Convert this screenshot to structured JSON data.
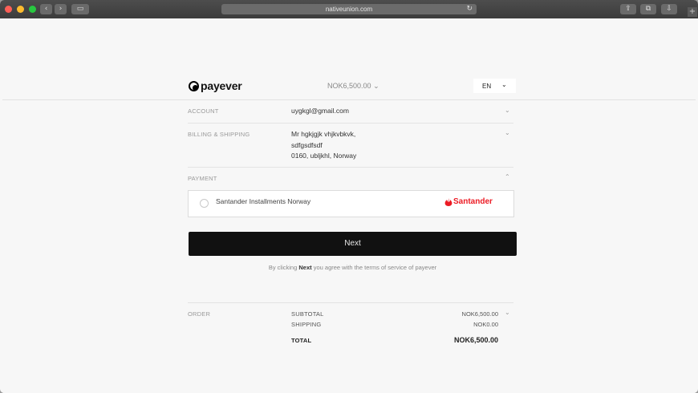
{
  "browser": {
    "url": "nativeunion.com"
  },
  "header": {
    "logo": "payever",
    "amount": "NOK6,500.00",
    "amount_chevron": "⌄",
    "language": "EN",
    "language_chevron": "⌄"
  },
  "account": {
    "label": "ACCOUNT",
    "value": "uygkgl@gmail.com"
  },
  "billing": {
    "label": "BILLING & SHIPPING",
    "lines": [
      "Mr hgkjgjk vhjkvbkvk,",
      "sdfgsdfsdf",
      "0160, ubljkhl, Norway"
    ]
  },
  "payment": {
    "label": "PAYMENT",
    "option_label": "Santander Installments Norway",
    "provider": "Santander"
  },
  "actions": {
    "next_label": "Next",
    "terms_prefix": "By clicking",
    "terms_bold": "Next",
    "terms_suffix": "you agree with the terms of service of payever"
  },
  "order": {
    "label": "ORDER",
    "subtotal_label": "SUBTOTAL",
    "subtotal_value": "NOK6,500.00",
    "shipping_label": "SHIPPING",
    "shipping_value": "NOK0.00",
    "total_label": "TOTAL",
    "total_value": "NOK6,500.00"
  },
  "colors": {
    "santander_red": "#ec1b24",
    "button_black": "#111111",
    "traffic_red": "#fe5f57",
    "traffic_yellow": "#febc2e",
    "traffic_green": "#28c840"
  }
}
